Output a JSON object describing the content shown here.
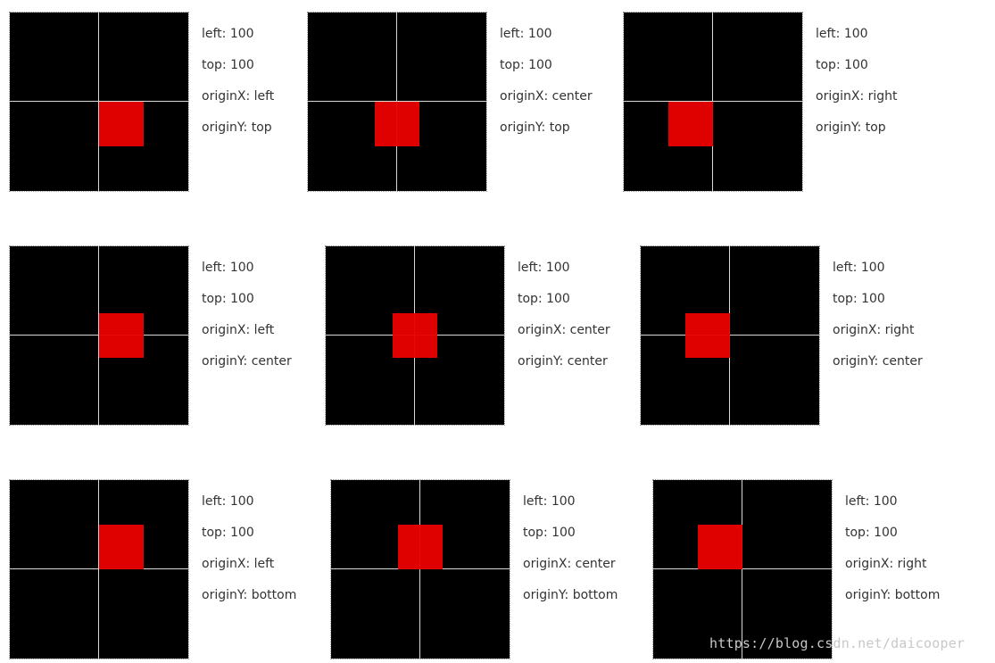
{
  "colors": {
    "canvas": "#000000",
    "axis": "#d8d8d8",
    "rect": "#e80000",
    "text": "#333333"
  },
  "examples": [
    {
      "left": "left: 100",
      "top": "top: 100",
      "originX": "originX: left",
      "originY": "originY: top"
    },
    {
      "left": "left: 100",
      "top": "top: 100",
      "originX": "originX: center",
      "originY": "originY: top"
    },
    {
      "left": "left: 100",
      "top": "top: 100",
      "originX": "originX: right",
      "originY": "originY: top"
    },
    {
      "left": "left: 100",
      "top": "top: 100",
      "originX": "originX: left",
      "originY": "originY: center"
    },
    {
      "left": "left: 100",
      "top": "top: 100",
      "originX": "originX: center",
      "originY": "originY: center"
    },
    {
      "left": "left: 100",
      "top": "top: 100",
      "originX": "originX: right",
      "originY": "originY: center"
    },
    {
      "left": "left: 100",
      "top": "top: 100",
      "originX": "originX: left",
      "originY": "originY: bottom"
    },
    {
      "left": "left: 100",
      "top": "top: 100",
      "originX": "originX: center",
      "originY": "originY: bottom"
    },
    {
      "left": "left: 100",
      "top": "top: 100",
      "originX": "originX: right",
      "originY": "originY: bottom"
    }
  ],
  "watermark": "https://blog.csdn.net/daicooper"
}
